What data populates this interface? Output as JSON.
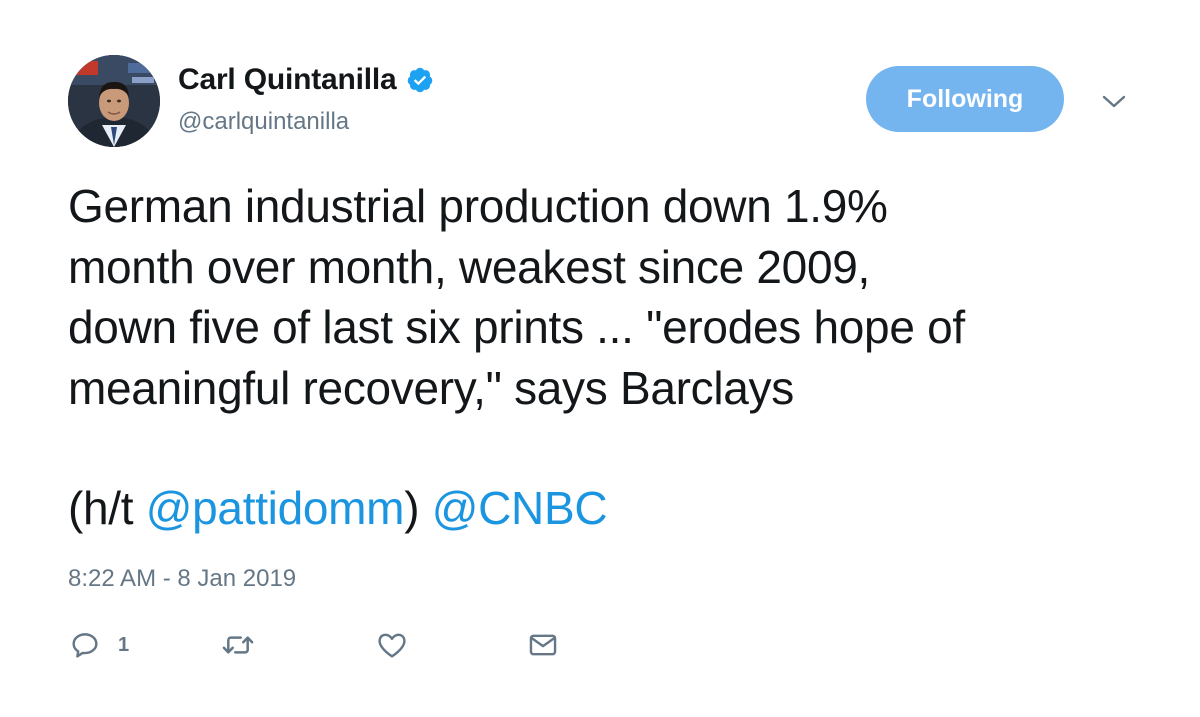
{
  "author": {
    "display_name": "Carl Quintanilla",
    "handle": "@carlquintanilla",
    "verified": true
  },
  "follow_button": {
    "label": "Following"
  },
  "tweet": {
    "lines": [
      "German industrial production down 1.9%",
      "month over month, weakest since 2009,",
      "down five of last six prints ... \"erodes hope of",
      "meaningful recovery,\" says Barclays"
    ],
    "credit_prefix": "(h/t ",
    "credit_mention": "@pattidomm",
    "credit_suffix": ") ",
    "trailing_mention": "@CNBC"
  },
  "timestamp": "8:22 AM - 8 Jan 2019",
  "actions": {
    "reply_count": "1",
    "icons": [
      "reply-icon",
      "retweet-icon",
      "like-icon",
      "direct-message-icon"
    ]
  },
  "colors": {
    "text": "#14171a",
    "secondary": "#657786",
    "link": "#1b95e0",
    "button_bg": "#74b5ef",
    "verified": "#1da1f2"
  }
}
